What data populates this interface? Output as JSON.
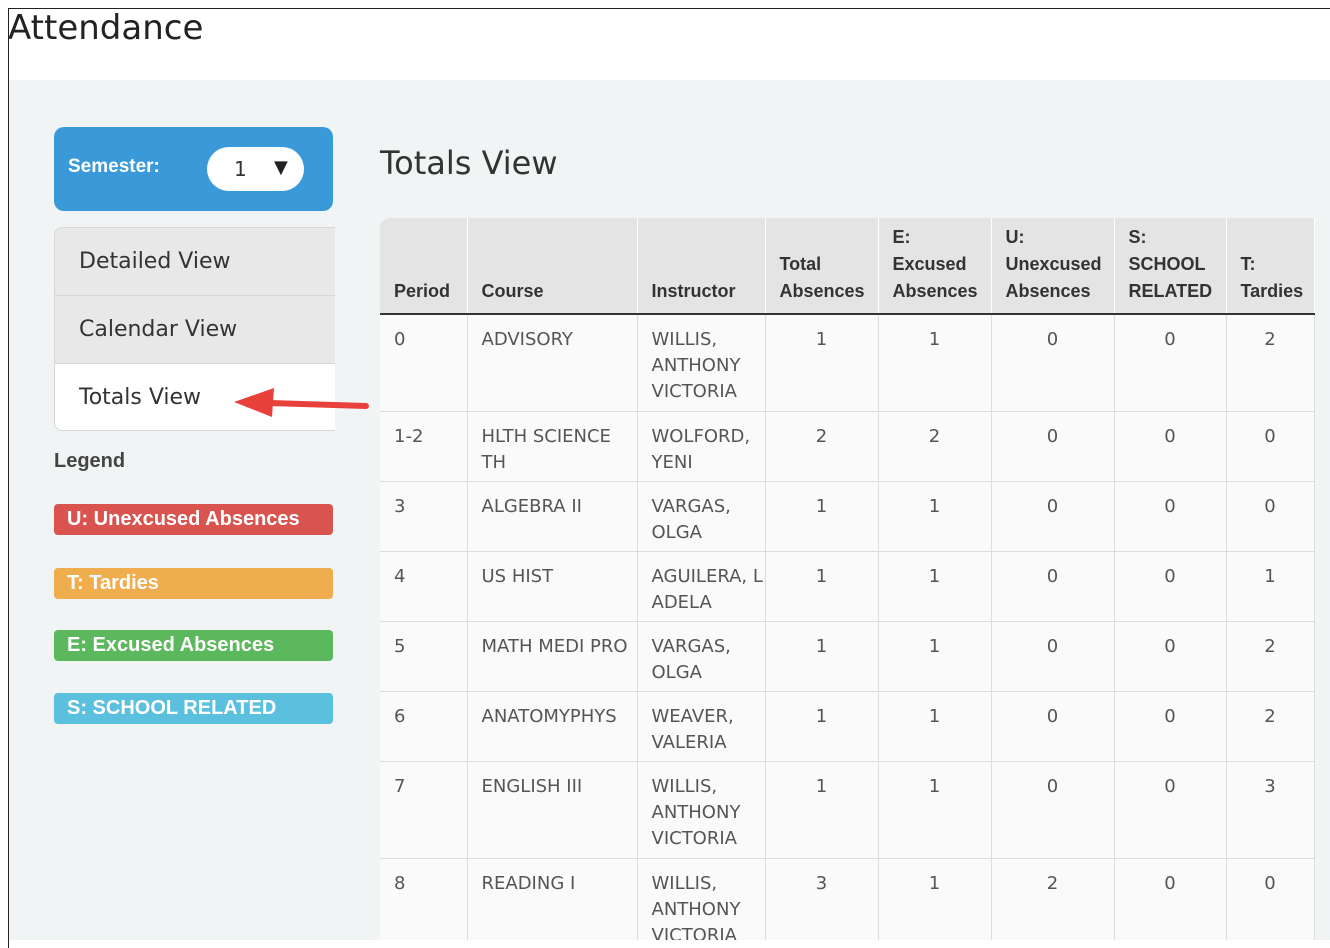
{
  "page": {
    "title": "Attendance"
  },
  "sidebar": {
    "semester": {
      "label": "Semester:",
      "value": "1"
    },
    "views": [
      {
        "label": "Detailed View",
        "active": false
      },
      {
        "label": "Calendar View",
        "active": false
      },
      {
        "label": "Totals View",
        "active": true
      }
    ],
    "legend": {
      "title": "Legend",
      "items": [
        {
          "label": "U: Unexcused Absences",
          "color": "#d9534f"
        },
        {
          "label": "T: Tardies",
          "color": "#f0ad4e"
        },
        {
          "label": "E: Excused Absences",
          "color": "#5cb85c"
        },
        {
          "label": "S: SCHOOL RELATED",
          "color": "#5bc0de"
        }
      ]
    }
  },
  "annotation": {
    "arrow_color": "#e8413c"
  },
  "main": {
    "title": "Totals View",
    "table": {
      "headers": {
        "period": "Period",
        "course": "Course",
        "instructor": "Instructor",
        "total_1": "Total",
        "total_2": "Absences",
        "excused_1": "E:",
        "excused_2": "Excused",
        "excused_3": "Absences",
        "unexcused_1": "U:",
        "unexcused_2": "Unexcused",
        "unexcused_3": "Absences",
        "school_1": "S:",
        "school_2": "SCHOOL",
        "school_3": "RELATED",
        "tardies_1": "T:",
        "tardies_2": "Tardies"
      },
      "rows": [
        {
          "period": "0",
          "course": "ADVISORY",
          "instructor": "WILLIS, ANTHONY VICTORIA",
          "total": "1",
          "excused": "1",
          "unexcused": "0",
          "school": "0",
          "tardies": "2"
        },
        {
          "period": "1-2",
          "course": "HLTH SCIENCE TH",
          "instructor": "WOLFORD, YENI",
          "total": "2",
          "excused": "2",
          "unexcused": "0",
          "school": "0",
          "tardies": "0"
        },
        {
          "period": "3",
          "course": "ALGEBRA II",
          "instructor": "VARGAS, OLGA",
          "total": "1",
          "excused": "1",
          "unexcused": "0",
          "school": "0",
          "tardies": "0"
        },
        {
          "period": "4",
          "course": "US HIST",
          "instructor": "AGUILERA, L ADELA",
          "total": "1",
          "excused": "1",
          "unexcused": "0",
          "school": "0",
          "tardies": "1"
        },
        {
          "period": "5",
          "course": "MATH MEDI PRO",
          "instructor": "VARGAS, OLGA",
          "total": "1",
          "excused": "1",
          "unexcused": "0",
          "school": "0",
          "tardies": "2"
        },
        {
          "period": "6",
          "course": "ANATOMYPHYS",
          "instructor": "WEAVER, VALERIA",
          "total": "1",
          "excused": "1",
          "unexcused": "0",
          "school": "0",
          "tardies": "2"
        },
        {
          "period": "7",
          "course": "ENGLISH III",
          "instructor": "WILLIS, ANTHONY VICTORIA",
          "total": "1",
          "excused": "1",
          "unexcused": "0",
          "school": "0",
          "tardies": "3"
        },
        {
          "period": "8",
          "course": "READING I",
          "instructor": "WILLIS, ANTHONY VICTORIA",
          "total": "3",
          "excused": "1",
          "unexcused": "2",
          "school": "0",
          "tardies": "0"
        }
      ]
    }
  }
}
